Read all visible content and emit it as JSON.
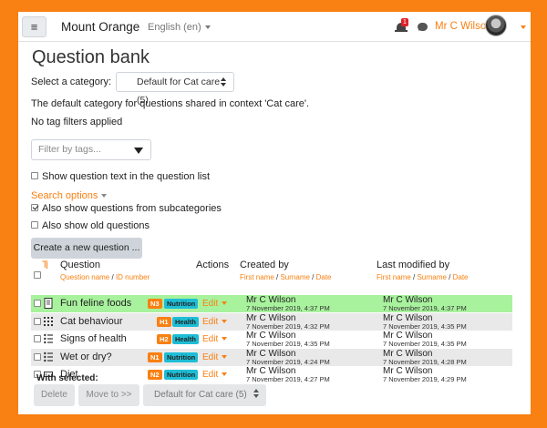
{
  "navbar": {
    "site_name": "Mount Orange",
    "language": "English (en)",
    "notification_count": "1",
    "user_name": "Mr C Wilson"
  },
  "page": {
    "title": "Question bank",
    "select_category_label": "Select a category:",
    "selected_category": "Default for Cat care (5)",
    "category_description": "The default category for questions shared in context 'Cat care'.",
    "tag_filters_status": "No tag filters applied",
    "tag_filter_placeholder": "Filter by tags...",
    "show_question_text_label": "Show question text in the question list",
    "show_question_text_checked": false,
    "search_options_label": "Search options",
    "subcategories_label": "Also show questions from subcategories",
    "subcategories_checked": true,
    "old_questions_label": "Also show old questions",
    "old_questions_checked": false,
    "create_button": "Create a new question ..."
  },
  "table": {
    "sort_label": "T",
    "col_question": "Question",
    "col_question_sub_a": "Question name",
    "col_question_sub_b": "ID number",
    "col_actions": "Actions",
    "col_created": "Created by",
    "col_created_sub_a": "First name",
    "col_created_sub_b": "Surname",
    "col_created_sub_c": "Date",
    "col_modified": "Last modified by",
    "col_modified_sub_a": "First name",
    "col_modified_sub_b": "Surname",
    "col_modified_sub_c": "Date",
    "separator": " / ",
    "edit_label": "Edit",
    "rows": [
      {
        "name": "Fun feline foods",
        "type_icon": "essay-icon",
        "id_number": "N3",
        "tag": "Nutrition",
        "created_by": "Mr C Wilson",
        "created_date": "7 November 2019, 4:37 PM",
        "modified_by": "Mr C Wilson",
        "modified_date": "7 November 2019, 4:37 PM",
        "highlight": "#a8f29d"
      },
      {
        "name": "Cat behaviour",
        "type_icon": "matching-icon",
        "id_number": "H1",
        "tag": "Health",
        "created_by": "Mr C Wilson",
        "created_date": "7 November 2019, 4:32 PM",
        "modified_by": "Mr C Wilson",
        "modified_date": "7 November 2019, 4:35 PM",
        "highlight": "#e9e9e9"
      },
      {
        "name": "Signs of health",
        "type_icon": "multichoice-icon",
        "id_number": "H2",
        "tag": "Health",
        "created_by": "Mr C Wilson",
        "created_date": "7 November 2019, 4:35 PM",
        "modified_by": "Mr C Wilson",
        "modified_date": "7 November 2019, 4:35 PM",
        "highlight": "#ffffff"
      },
      {
        "name": "Wet or dry?",
        "type_icon": "multichoice-icon",
        "id_number": "N1",
        "tag": "Nutrition",
        "created_by": "Mr C Wilson",
        "created_date": "7 November 2019, 4:24 PM",
        "modified_by": "Mr C Wilson",
        "modified_date": "7 November 2019, 4:28 PM",
        "highlight": "#e9e9e9"
      },
      {
        "name": "Diet",
        "type_icon": "shortanswer-icon",
        "id_number": "N2",
        "tag": "Nutrition",
        "created_by": "Mr C Wilson",
        "created_date": "7 November 2019, 4:27 PM",
        "modified_by": "Mr C Wilson",
        "modified_date": "7 November 2019, 4:29 PM",
        "highlight": "#ffffff"
      }
    ]
  },
  "bulk": {
    "with_selected": "With selected:",
    "delete_button": "Delete",
    "move_button": "Move to >>",
    "target_category": "Default for Cat care (5)"
  },
  "colors": {
    "accent": "#f98012",
    "tag": "#1ebdd6"
  }
}
